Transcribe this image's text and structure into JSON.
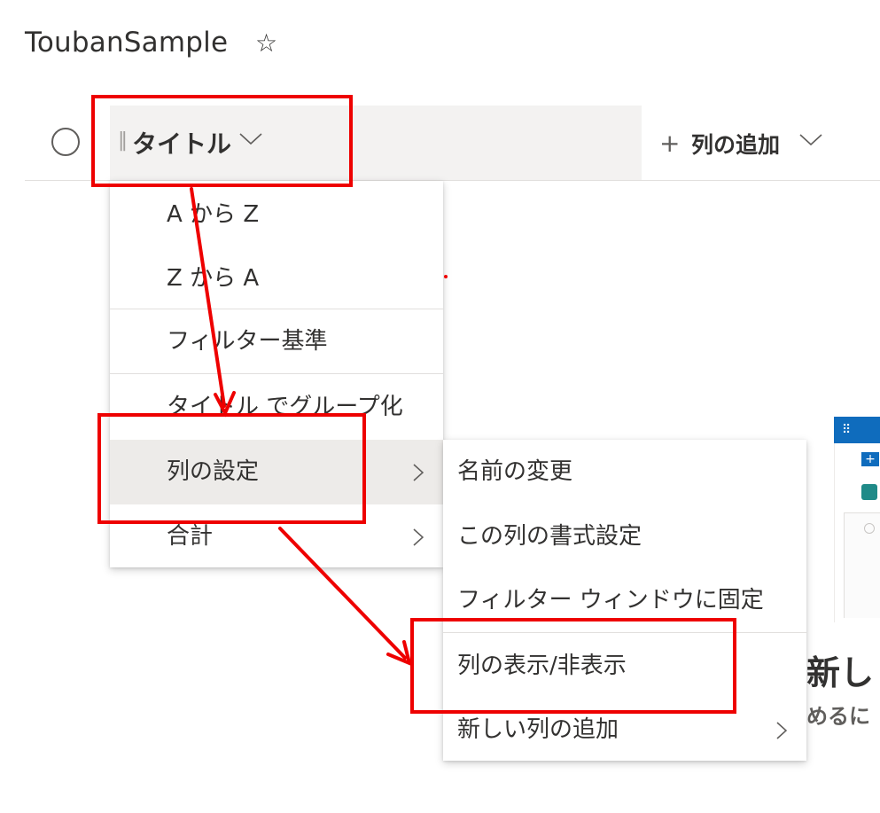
{
  "header": {
    "list_title": "ToubanSample",
    "favorite_icon": "☆"
  },
  "columns": {
    "title_label": "タイトル",
    "add_column_label": "列の追加",
    "add_column_icon": "+"
  },
  "column_menu": {
    "items": [
      {
        "label": "A から Z"
      },
      {
        "label": "Z から A"
      },
      {
        "label": "フィルター基準"
      },
      {
        "label": "タイトル でグループ化"
      },
      {
        "label": "列の設定",
        "has_submenu": true,
        "highlighted": true
      },
      {
        "label": "合計",
        "has_submenu": true
      }
    ]
  },
  "column_settings_submenu": {
    "items": [
      {
        "label": "名前の変更"
      },
      {
        "label": "この列の書式設定"
      },
      {
        "label": "フィルター ウィンドウに固定"
      },
      {
        "label": "列の表示/非表示"
      },
      {
        "label": "新しい列の追加",
        "has_submenu": true
      }
    ]
  },
  "empty_state": {
    "heading_fragment": "新し",
    "subtext_fragment": "めるに"
  },
  "colors": {
    "annotation_red": "#ee0000",
    "highlight_bg": "#edebe9",
    "header_bg": "#f3f2f1",
    "brand_blue": "#0f6cbd"
  }
}
